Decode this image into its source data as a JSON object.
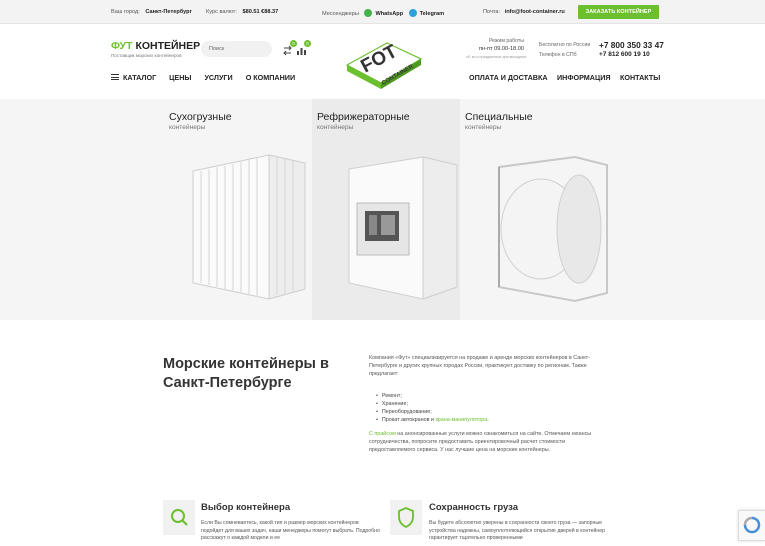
{
  "topbar": {
    "city_label": "Ваш город:",
    "city_value": "Санкт-Петербург",
    "rate_label": "Курс валют:",
    "rate_value": "$80.51 €88.37",
    "messengers_label": "Мессенджеры",
    "whatsapp": "WhatsApp",
    "telegram": "Telegram",
    "mail_label": "Почта:",
    "mail_value": "info@foot-container.ru",
    "order_button": "ЗАКАЗАТЬ КОНТЕЙНЕР"
  },
  "header": {
    "logo_prefix": "ФУТ",
    "logo_main": "КОНТЕЙНЕР",
    "logo_sub": "Поставщик морских контейнеров",
    "search_placeholder": "Поиск",
    "compare_count": "0",
    "favorites_count": "0",
    "center_logo_big": "FOT",
    "center_logo_small": "CONTAINER",
    "hours_label": "Режим работы",
    "hours_value": "пн-пт 09.00-18.00",
    "hours_note": "сб, вс и праздничные дни выходные",
    "phone_free_label": "Бесплатно по России",
    "phone_free": "+7 800 350 33 47",
    "phone_spb_label": "Телефон в СПб",
    "phone_spb": "+7 812 600 19 10"
  },
  "nav": {
    "catalog": "КАТАЛОГ",
    "prices": "ЦЕНЫ",
    "services": "УСЛУГИ",
    "about": "О КОМПАНИИ",
    "payment": "ОПЛАТА И ДОСТАВКА",
    "info": "ИНФОРМАЦИЯ",
    "contacts": "КОНТАКТЫ"
  },
  "hero": {
    "cards": [
      {
        "title": "Сухогрузные",
        "subtitle": "контейнеры"
      },
      {
        "title": "Рефрижераторные",
        "subtitle": "контейнеры"
      },
      {
        "title": "Специальные",
        "subtitle": "контейнеры"
      }
    ]
  },
  "about": {
    "heading": "Морские контейнеры в Санкт-Петербурге",
    "intro": "Компания «Фут» специализируется на продаже и аренде морских контейнеров в Санкт-Петербурге и других крупных городах России, практикует доставку по регионам. Также предлагает:",
    "list": [
      "Ремонт;",
      "Хранение;",
      "Переоборудование;",
      "Прокат автокранов и "
    ],
    "list_link": "крана-манипулятора",
    "list_link_tail": ".",
    "price_link": "С прайсом",
    "outro": " на анонсированные услуги можно ознакомиться на сайте. Отмечаем нюансы сотрудничества, попросите предоставить ориентировочный расчет стоимости предоставляемого сервиса. У нас лучшие цена на морские контейнеры."
  },
  "features": [
    {
      "title": "Выбор контейнера",
      "text": "Если Вы сомневаетесь, какой тип и размер морских контейнеров подойдет для ваших задач, наши менеджеры помогут выбрать. Подробно расскажут о каждой модели и ее"
    },
    {
      "title": "Сохранность груза",
      "text": "Вы будете абсолютно уверены в сохранности своего груза — запорные устройства надежны, самоуплотняющийся открытие дверей в контейнер гарантирует тщательно проверенными"
    }
  ],
  "colors": {
    "accent": "#6cbf2f",
    "hero_bg": "#f5f5f5",
    "topbar_bg": "#f3f3f3"
  }
}
